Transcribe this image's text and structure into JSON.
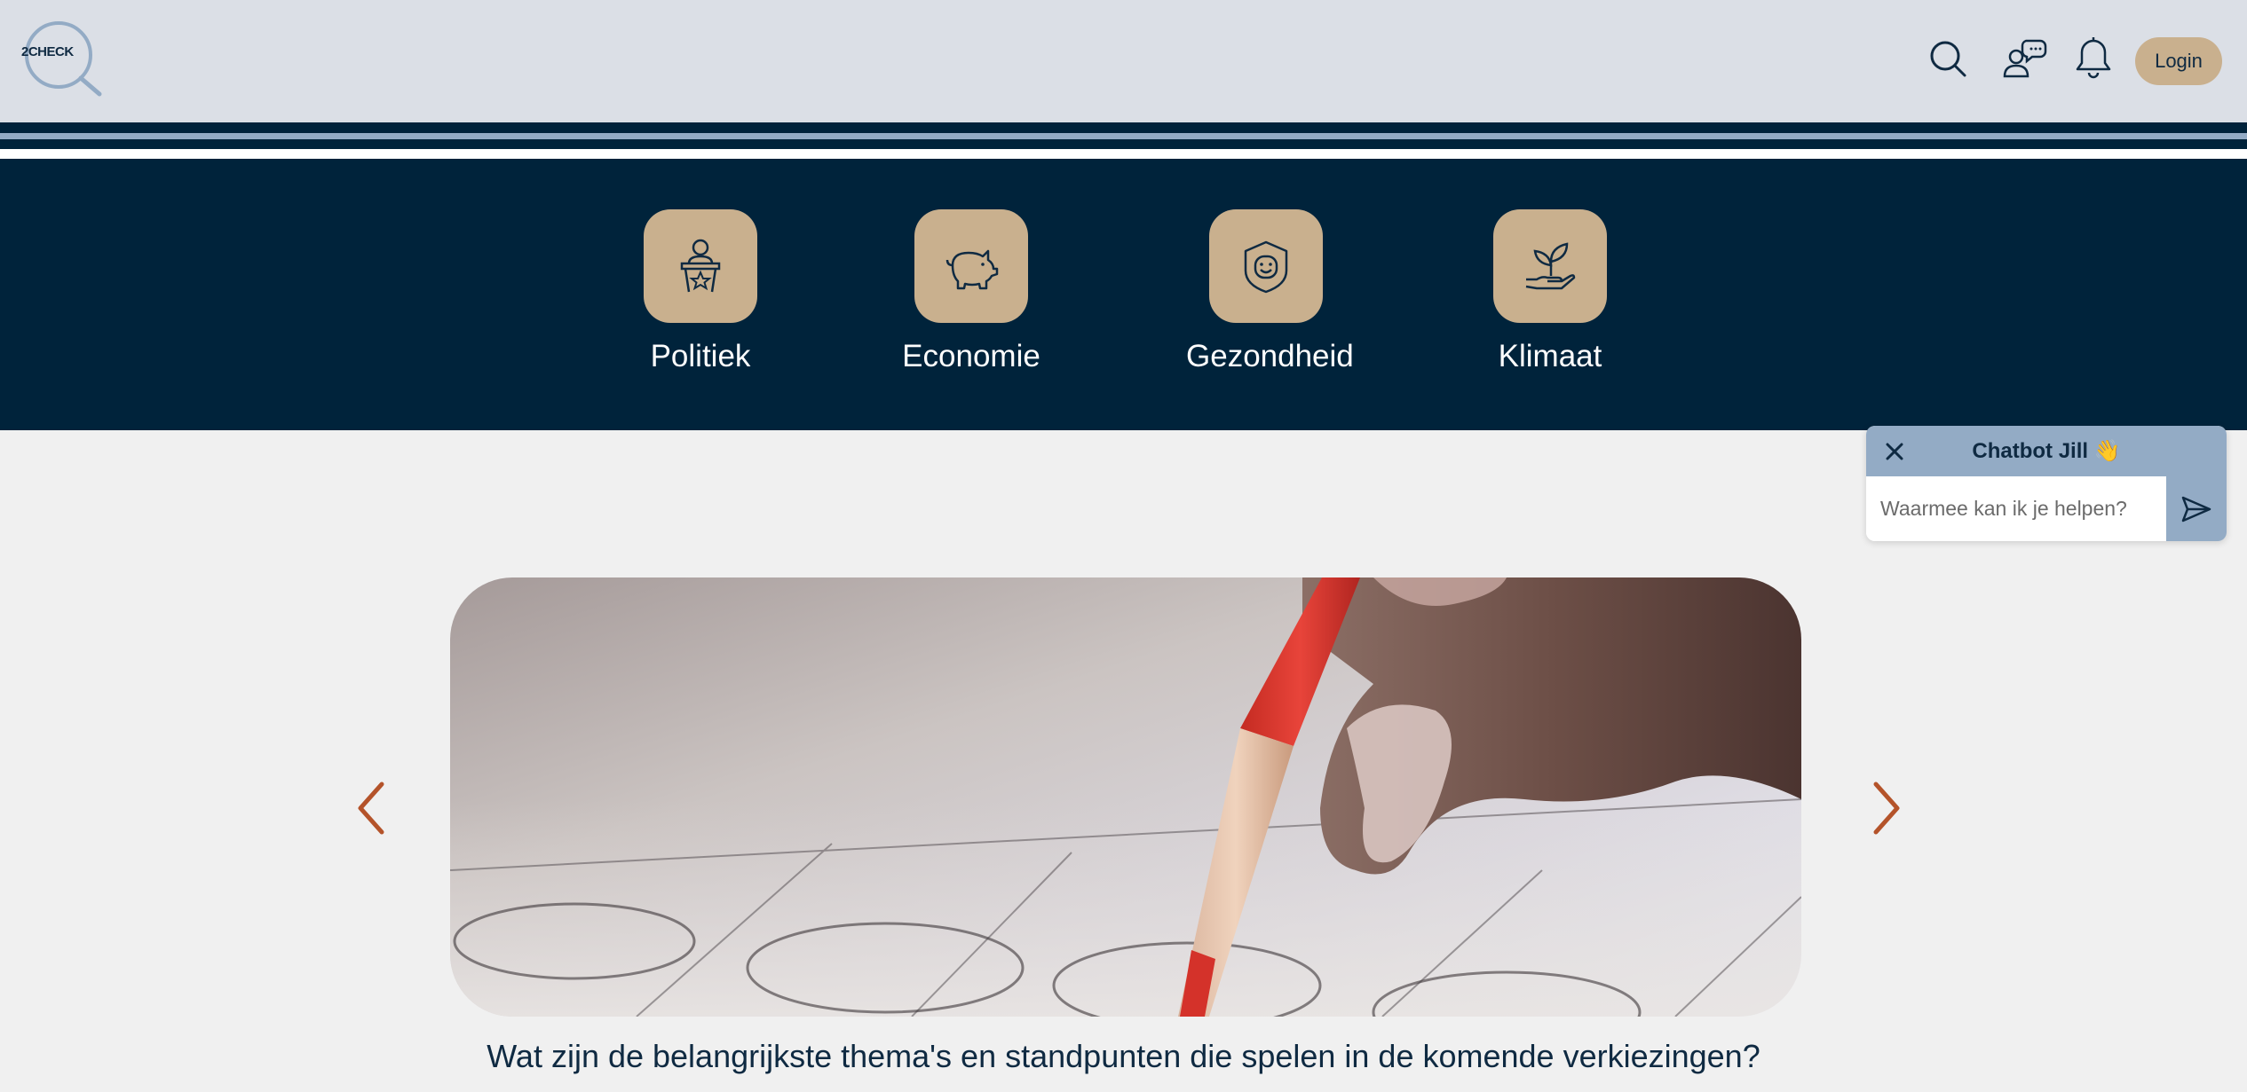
{
  "header": {
    "logo_text": "2CHECK",
    "login_label": "Login",
    "icons": [
      "search-icon",
      "chat-users-icon",
      "bell-icon"
    ]
  },
  "categories": [
    {
      "label": "Politiek",
      "icon": "podium-icon"
    },
    {
      "label": "Economie",
      "icon": "piggy-bank-icon"
    },
    {
      "label": "Gezondheid",
      "icon": "health-shield-icon"
    },
    {
      "label": "Klimaat",
      "icon": "plant-hand-icon"
    }
  ],
  "carousel": {
    "caption": "Wat zijn de belangrijkste thema's en standpunten die spelen in de komende verkiezingen?"
  },
  "chatbot": {
    "title": "Chatbot Jill 👋",
    "placeholder": "Waarmee kan ik je helpen?"
  },
  "colors": {
    "header_bg": "#dbdfe6",
    "navy": "#00233b",
    "tan": "#c9b08e",
    "arrow": "#b4532a",
    "chat_accent": "#93abc5"
  }
}
